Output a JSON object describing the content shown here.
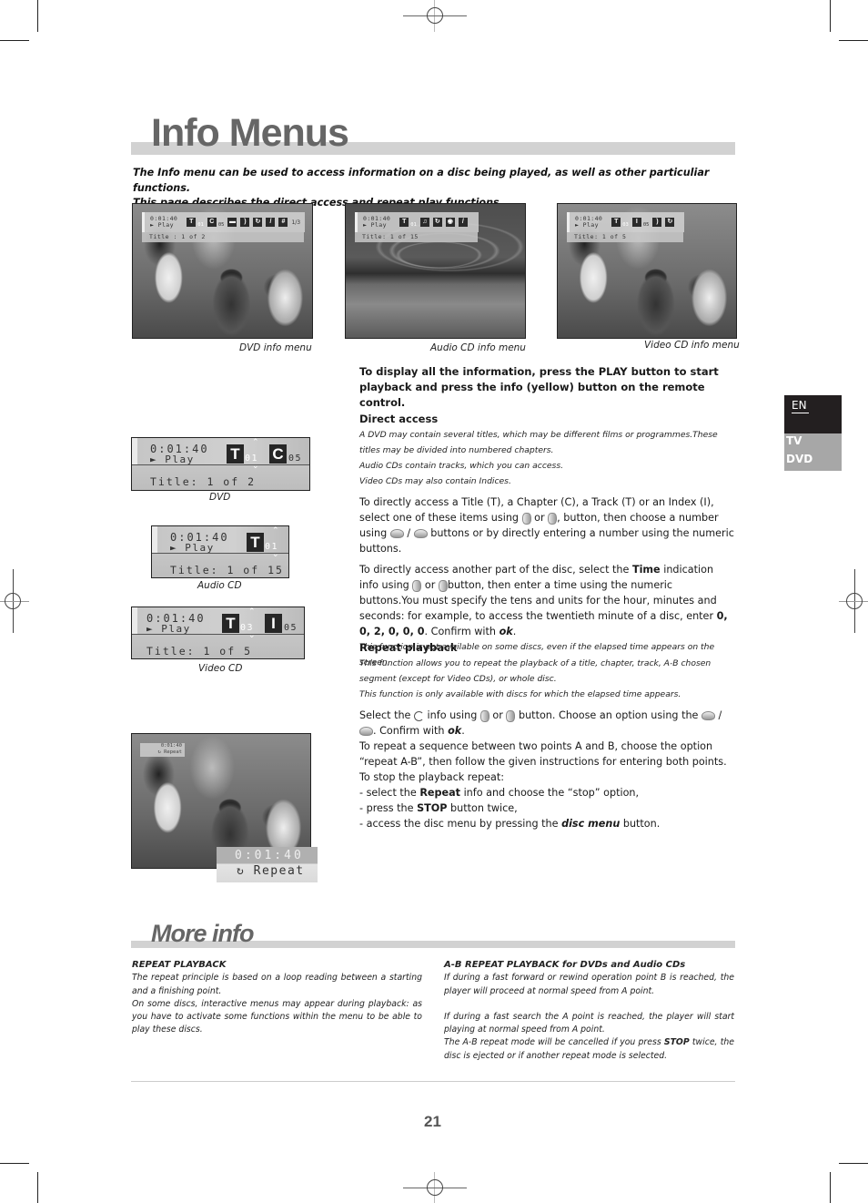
{
  "header": {
    "title": "Info Menus",
    "intro_line1": "The Info menu can be used to access information on a disc being played, as well as other particuliar functions.",
    "intro_line2": "This page describes the direct access and repeat play functions."
  },
  "screenshots": [
    {
      "caption": "DVD info menu",
      "time": "0:01:40",
      "state": "► Play",
      "title_line": "Title : 1 of 2",
      "t_num": "01",
      "c_num": "05",
      "icons": [
        "title-icon",
        "chapter-icon",
        "subtitle-icon",
        "audio-icon",
        "repeat-icon",
        "zoom-icon",
        "angle-icon"
      ],
      "angle": "1/3"
    },
    {
      "caption": "Audio CD info menu",
      "time": "0:01:40",
      "state": "► Play",
      "title_line": "Title: 1 of 15",
      "t_num": "01",
      "icons": [
        "track-icon",
        "music-note-icon",
        "repeat-icon",
        "disc-icon",
        "zoom-icon"
      ]
    },
    {
      "caption": "Video CD info menu",
      "time": "0:01:40",
      "state": "► Play",
      "title_line": "Title: 1 of 5",
      "t_num": "03",
      "i_num": "05",
      "icons": [
        "track-icon",
        "index-icon",
        "audio-icon",
        "repeat-icon"
      ]
    }
  ],
  "panels": {
    "dvd": {
      "time": "0:01:40",
      "state": "Play",
      "letter1": "T",
      "num1": "01",
      "letter2": "C",
      "num2": "05",
      "title": "Title:  1  of  2",
      "caption": "DVD"
    },
    "audio_cd": {
      "time": "0:01:40",
      "state": "Play",
      "letter1": "T",
      "num1": "01",
      "title": "Title: 1 of 15",
      "caption": "Audio CD"
    },
    "video_cd": {
      "time": "0:01:40",
      "state": "Play",
      "letter1": "T",
      "num1": "03",
      "letter2": "I",
      "num2": "05",
      "title": "Title: 1 of 5",
      "caption": "Video CD"
    },
    "repeat": {
      "time": "0:01:40",
      "label": "Repeat",
      "small_time": "0:01:40",
      "small_label": "Repeat"
    }
  },
  "main": {
    "lead_1": "To display all the information, press the ",
    "lead_play": "PLAY",
    "lead_2": " button to start playback and press the info (yellow) button on the remote control.",
    "direct_access": {
      "heading": "Direct access",
      "note1": "A DVD may contain several titles, which may be different films or programmes.These titles may be divided into numbered chapters.",
      "note2": "Audio CDs contain tracks, which you can access.",
      "note3": "Video CDs may also contain Indices.",
      "p1_a": "To directly access a Title (T), a Chapter (C), a Track (T) or an Index (I), select one of these items using ",
      "p1_or": " or ",
      "p1_b": ", button, then choose a number using ",
      "p1_slash": " / ",
      "p1_c": " buttons or by directly entering a number using the numeric buttons.",
      "p2_a": "To directly access another part of the disc, select the ",
      "p2_time": "Time",
      "p2_b": " indication info using ",
      "p2_or": " or ",
      "p2_c": "button, then enter a time using the numeric buttons.You must specify the tens and units for the hour, minutes and seconds: for example, to access the twentieth minute of a disc, enter ",
      "p2_digits": "0, 0, 2, 0, 0, 0",
      "p2_d": ". Confirm with ",
      "p2_ok": "ok",
      "p2_e": ".",
      "note4": "This function is not available on some discs, even if the elapsed time appears on the screen."
    },
    "repeat_playback": {
      "heading": "Repeat playback",
      "note1": "This function allows you to repeat the playback of a title, chapter, track, A-B chosen segment (except for Video CDs), or whole disc.",
      "note2": "This function is only available with discs for which the elapsed time appears.",
      "p1_a": "Select the ",
      "p1_b": " info using ",
      "p1_or": " or ",
      "p1_c": " button. Choose an option using the ",
      "p1_slash": " / ",
      "p1_d": ". Confirm with ",
      "p1_ok": "ok",
      "p1_e": ".",
      "p2": "To repeat a sequence between two points A and B, choose the option “repeat A-B”, then follow the given instructions for entering both points.",
      "p3": "To stop the playback repeat:",
      "b1_a": "- select the ",
      "b1_bold": "Repeat",
      "b1_b": " info and choose the “stop” option,",
      "b2_a": "- press the ",
      "b2_bold": "STOP",
      "b2_b": " button twice,",
      "b3_a": "- access the disc menu by pressing the ",
      "b3_bold": "disc menu",
      "b3_b": " button."
    }
  },
  "side_tab": {
    "lang": "EN",
    "item1": "TV",
    "item2": "DVD"
  },
  "more_info": {
    "title": "More info",
    "left": {
      "heading": "REPEAT PLAYBACK",
      "p1": "The repeat principle is based on a loop reading between a starting and a finishing point.",
      "p2": "On some discs, interactive menus may appear during playback: as you have to activate some functions within the menu to be able to play these discs."
    },
    "right": {
      "heading": "A-B REPEAT PLAYBACK for DVDs and Audio CDs",
      "p1": "If during a fast forward or rewind operation point B is reached, the player will proceed at normal speed from A point.",
      "p2": "If during a fast search the A point is reached, the player will start playing at normal speed from A point.",
      "p3_a": "The A-B repeat mode will be cancelled if you press ",
      "p3_bold": "STOP",
      "p3_b": " twice, the disc is ejected or if another repeat mode is selected."
    }
  },
  "footer": {
    "page_number": "21"
  }
}
